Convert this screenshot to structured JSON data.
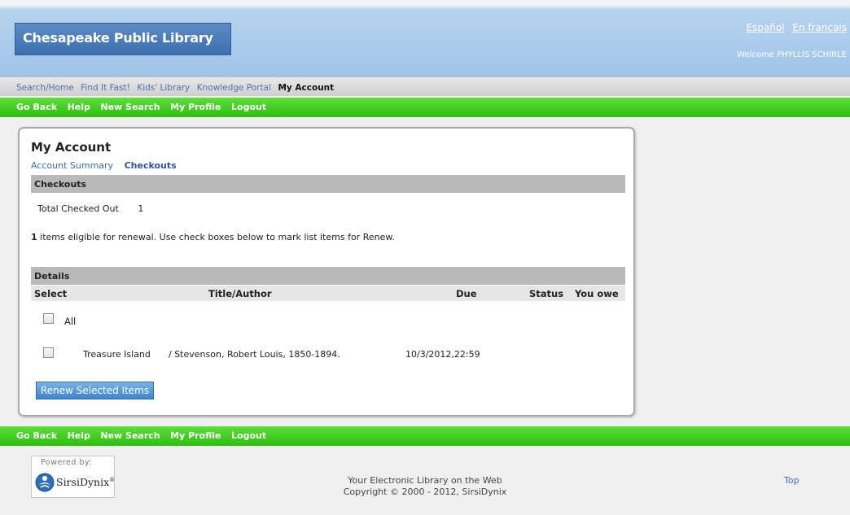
{
  "header": {
    "logo_text": "Chesapeake Public Library",
    "lang_links": [
      "Español",
      "En français"
    ],
    "welcome": "Welcome PHYLLIS SCHIRLE"
  },
  "nav": {
    "items": [
      "Search/Home",
      "Find It Fast!",
      "Kids' Library",
      "Knowledge Portal",
      "My Account"
    ],
    "active": "My Account"
  },
  "action_bar": {
    "items": [
      "Go Back",
      "Help",
      "New Search",
      "My Profile",
      "Logout"
    ]
  },
  "account": {
    "title": "My Account",
    "tabs": [
      "Account Summary",
      "Checkouts"
    ],
    "active_tab": "Checkouts",
    "checkouts_header": "Checkouts",
    "total_label": "Total Checked Out",
    "total_value": "1",
    "eligible_count": "1",
    "eligible_text": " items eligible for renewal. Use check boxes below to mark list items for Renew.",
    "details_header": "Details",
    "columns": [
      "Select",
      "Title/Author",
      "Due",
      "Status",
      "You owe"
    ],
    "select_all_label": "All",
    "select_all_checked": false,
    "items": [
      {
        "title": "Treasure Island",
        "author": "/ Stevenson, Robert Louis, 1850-1894.",
        "due": "10/3/2012,22:59",
        "status": "",
        "owe": "",
        "checked": false
      }
    ],
    "renew_button": "Renew Selected Items"
  },
  "footer": {
    "powered_by": "Powered by:",
    "vendor": "SirsiDynix",
    "vendor_mark": "®",
    "line1": "Your Electronic Library on the Web",
    "line2": "Copyright © 2000 - 2012, SirsiDynix",
    "top_link": "Top"
  },
  "colors": {
    "header_blue": "#a9cbeb",
    "logo_blue": "#3d6fb0",
    "action_green": "#2fbd10",
    "link_blue": "#3f6bb5",
    "section_gray": "#b9b9b9",
    "button_blue": "#3b85cf"
  }
}
